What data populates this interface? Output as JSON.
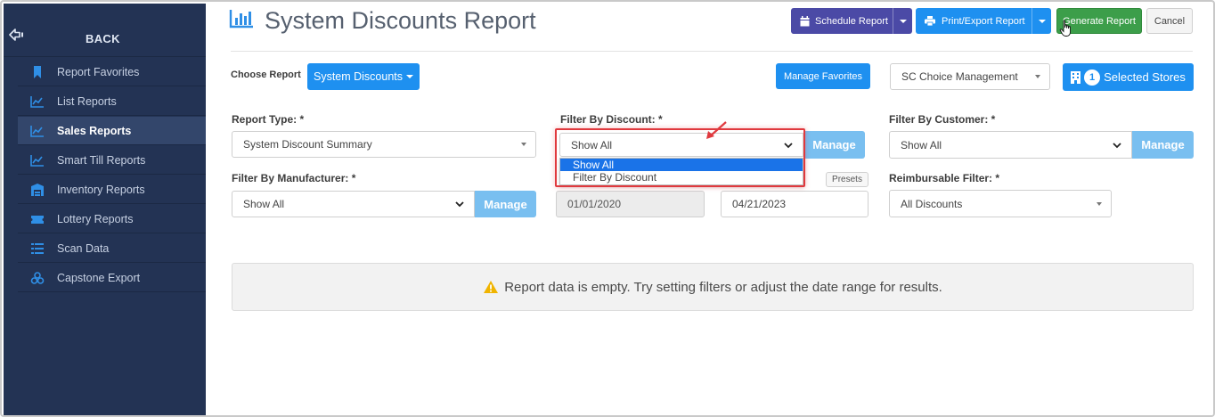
{
  "sidebar": {
    "back_label": "BACK",
    "items": [
      {
        "label": "Report Favorites",
        "icon": "bookmark-icon"
      },
      {
        "label": "List Reports",
        "icon": "chart-line-icon"
      },
      {
        "label": "Sales Reports",
        "icon": "chart-line-icon"
      },
      {
        "label": "Smart Till Reports",
        "icon": "chart-line-icon"
      },
      {
        "label": "Inventory Reports",
        "icon": "warehouse-icon"
      },
      {
        "label": "Lottery Reports",
        "icon": "ticket-icon"
      },
      {
        "label": "Scan Data",
        "icon": "list-icon"
      },
      {
        "label": "Capstone Export",
        "icon": "boxes-icon"
      }
    ],
    "active_item": "Sales Reports"
  },
  "header": {
    "title": "System Discounts Report",
    "schedule_label": "Schedule Report",
    "print_label": "Print/Export Report",
    "generate_label": "Generate Report",
    "cancel_label": "Cancel"
  },
  "toolbar": {
    "choose_report_label": "Choose Report",
    "report_button_label": "System Discounts",
    "manage_favorites_label": "Manage Favorites",
    "store_group_value": "SC Choice Management",
    "selected_stores_count": "1",
    "selected_stores_label": "Selected Stores"
  },
  "filters": {
    "report_type": {
      "label": "Report Type: *",
      "value": "System Discount Summary"
    },
    "discount": {
      "label": "Filter By Discount: *",
      "value": "Show All",
      "manage_label": "Manage",
      "options": [
        "Show All",
        "Filter By Discount"
      ]
    },
    "customer": {
      "label": "Filter By Customer: *",
      "value": "Show All",
      "manage_label": "Manage"
    },
    "manufacturer": {
      "label": "Filter By Manufacturer: *",
      "value": "Show All",
      "manage_label": "Manage"
    },
    "start_date": "01/01/2020",
    "end_date": "04/21/2023",
    "presets_label": "Presets",
    "reimbursable": {
      "label": "Reimbursable Filter: *",
      "value": "All Discounts"
    }
  },
  "empty_message": "Report data is empty. Try setting filters or adjust the date range for results.",
  "colors": {
    "sidebar_bg": "#233354",
    "primary_blue": "#1e90f0",
    "schedule_purple": "#4b4aa6",
    "generate_green": "#3c9e4a",
    "highlight_red": "#e0393e"
  }
}
